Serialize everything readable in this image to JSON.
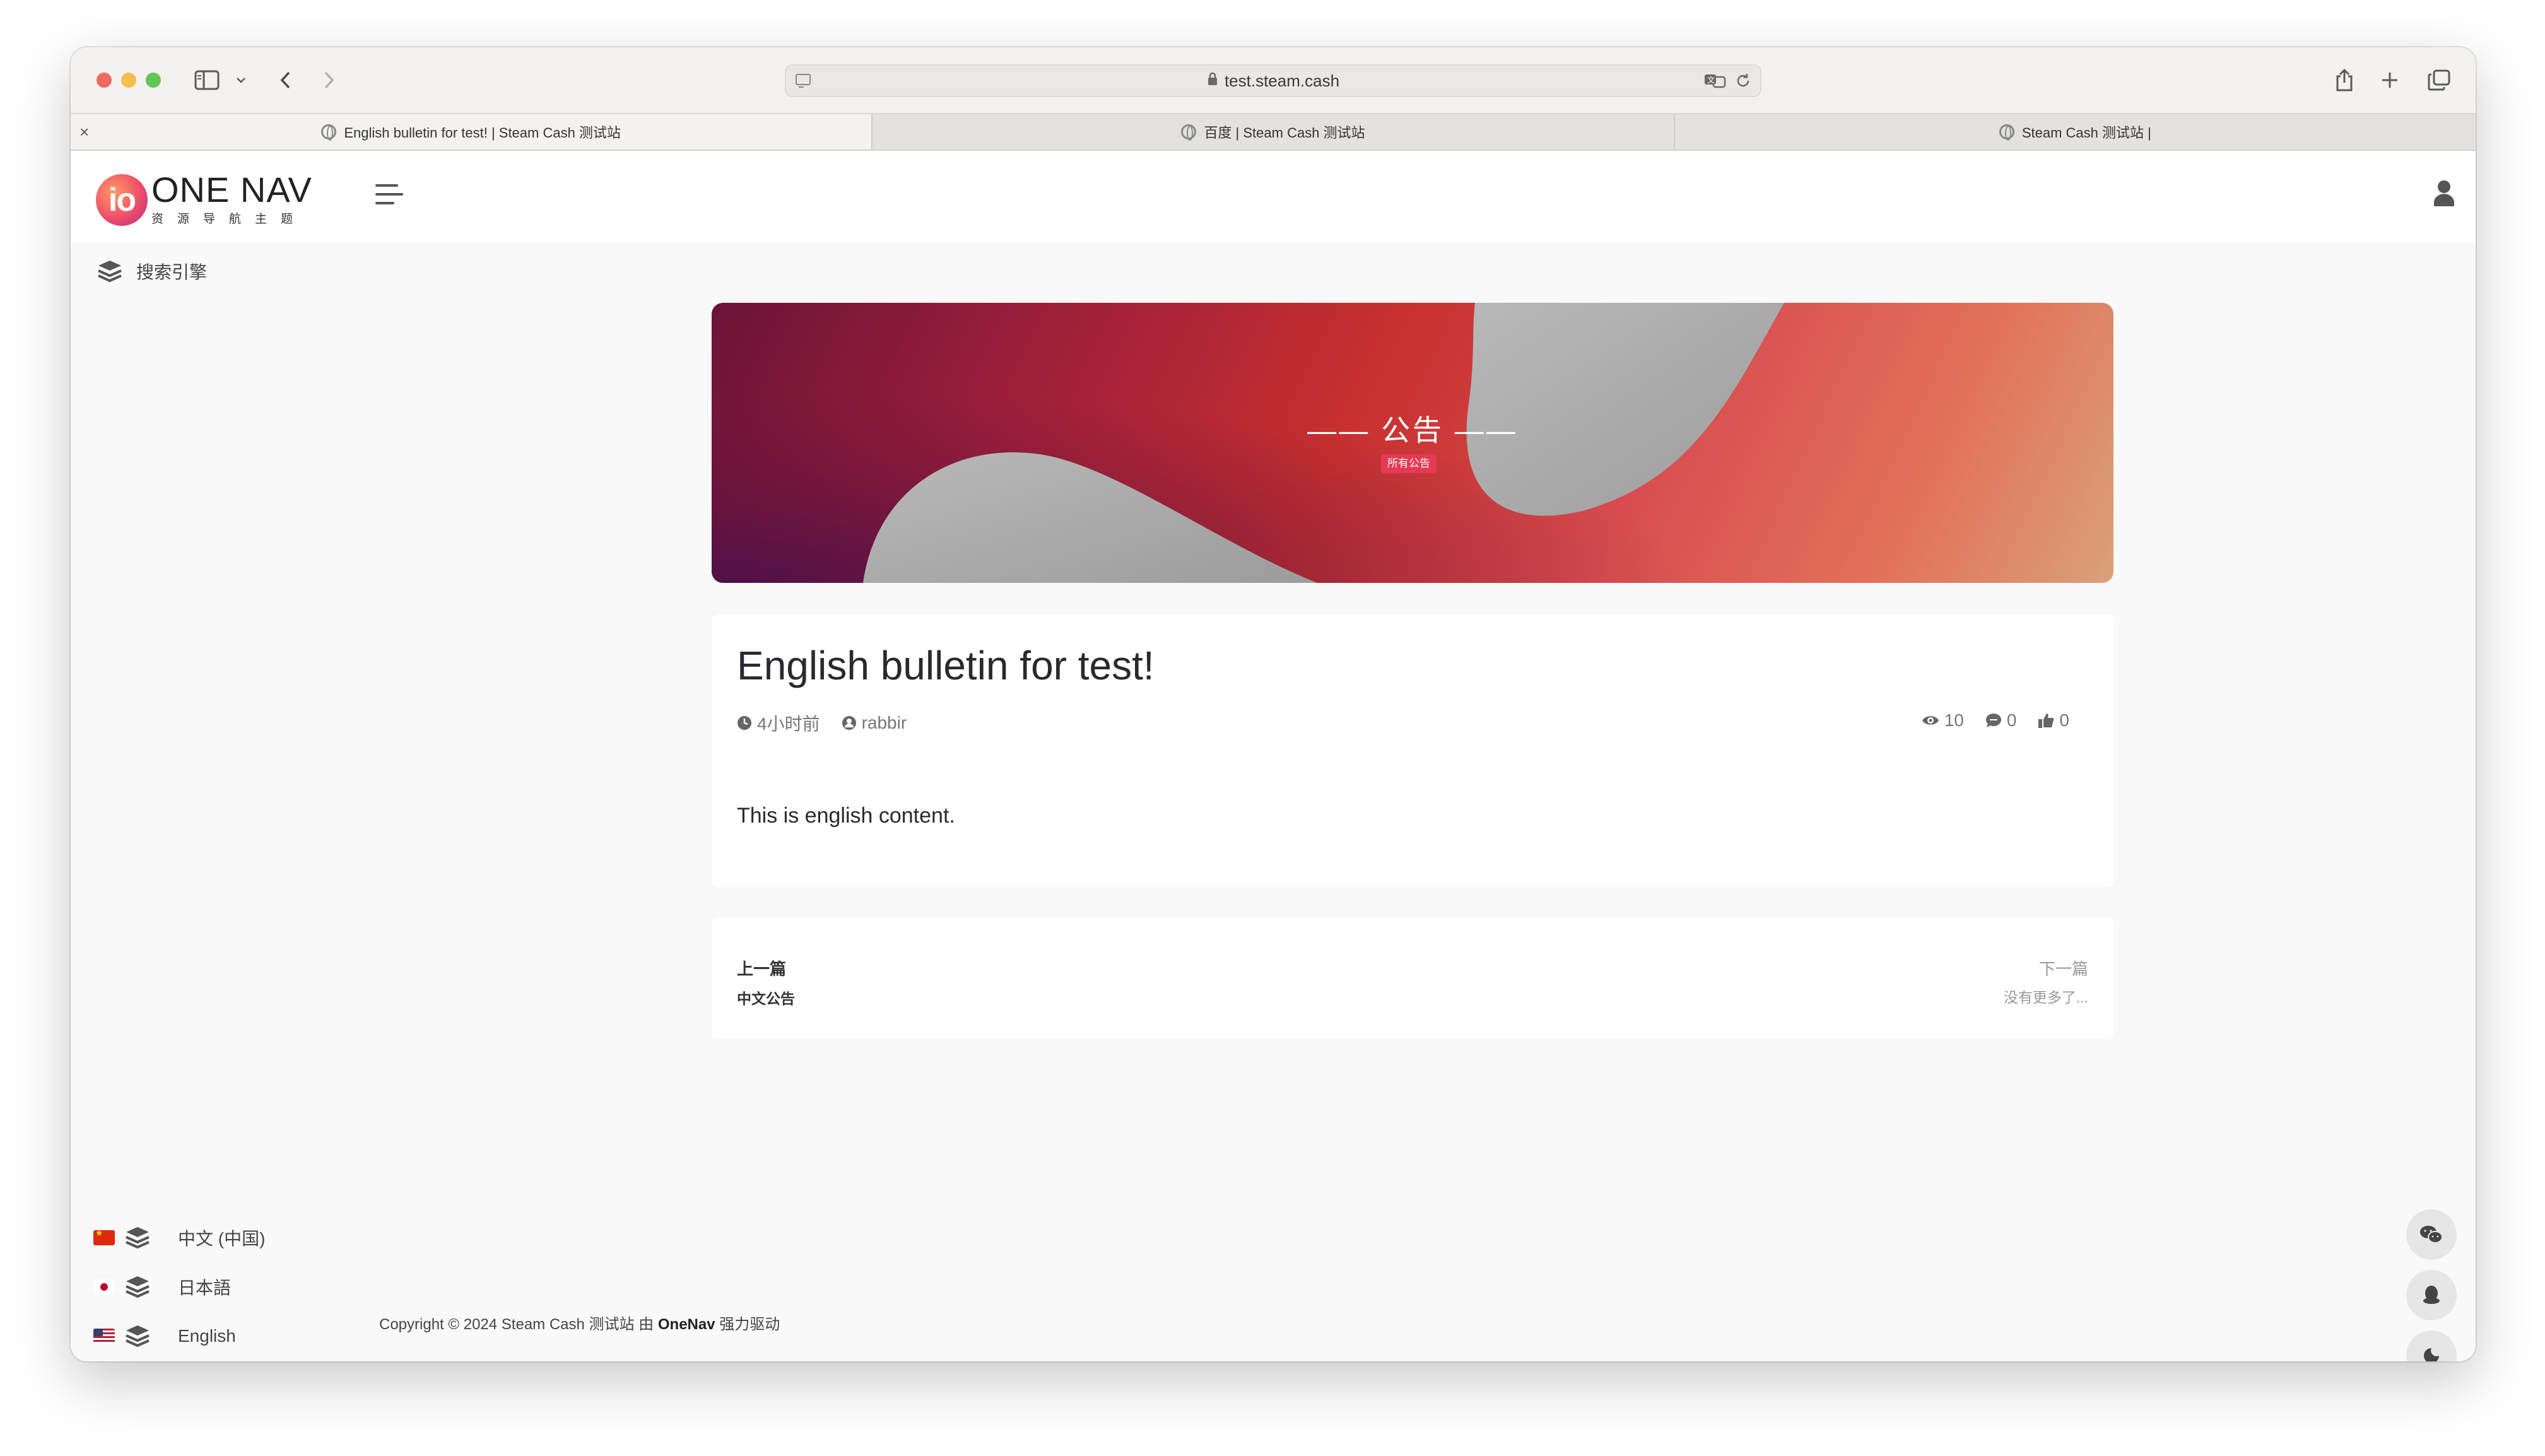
{
  "browser": {
    "url": "test.steam.cash",
    "tabs": [
      {
        "title": "English bulletin for test! | Steam Cash 测试站",
        "active": true
      },
      {
        "title": "百度 | Steam Cash 测试站",
        "active": false
      },
      {
        "title": "Steam Cash 测试站 |",
        "active": false
      }
    ],
    "tab_close_glyph": "×"
  },
  "header": {
    "logo_mark": "io",
    "logo_title": "ONE NAV",
    "logo_subtitle": "资源导航主题"
  },
  "sidebar": {
    "search_engine_label": "搜索引擎",
    "languages": [
      {
        "label": "中文 (中国)",
        "flag": "cn"
      },
      {
        "label": "日本語",
        "flag": "jp"
      },
      {
        "label": "English",
        "flag": "us"
      }
    ]
  },
  "banner": {
    "title": "—— 公告 ——",
    "badge": "所有公告",
    "colors": [
      "#6b1438",
      "#c7302e",
      "#e2735a",
      "#d9a17a"
    ]
  },
  "article": {
    "title": "English bulletin for test!",
    "time": "4小时前",
    "author": "rabbir",
    "views": "10",
    "comments": "0",
    "likes": "0",
    "content": "This is english content."
  },
  "post_nav": {
    "prev_label": "上一篇",
    "prev_title": "中文公告",
    "next_label": "下一篇",
    "next_title": "没有更多了..."
  },
  "footer": {
    "copyright_prefix": "Copyright © 2024 Steam Cash 测试站 由 ",
    "brand": "OneNav",
    "copyright_suffix": " 强力驱动"
  },
  "floating_buttons": [
    "wechat-icon",
    "qq-icon",
    "dark-mode-icon"
  ]
}
